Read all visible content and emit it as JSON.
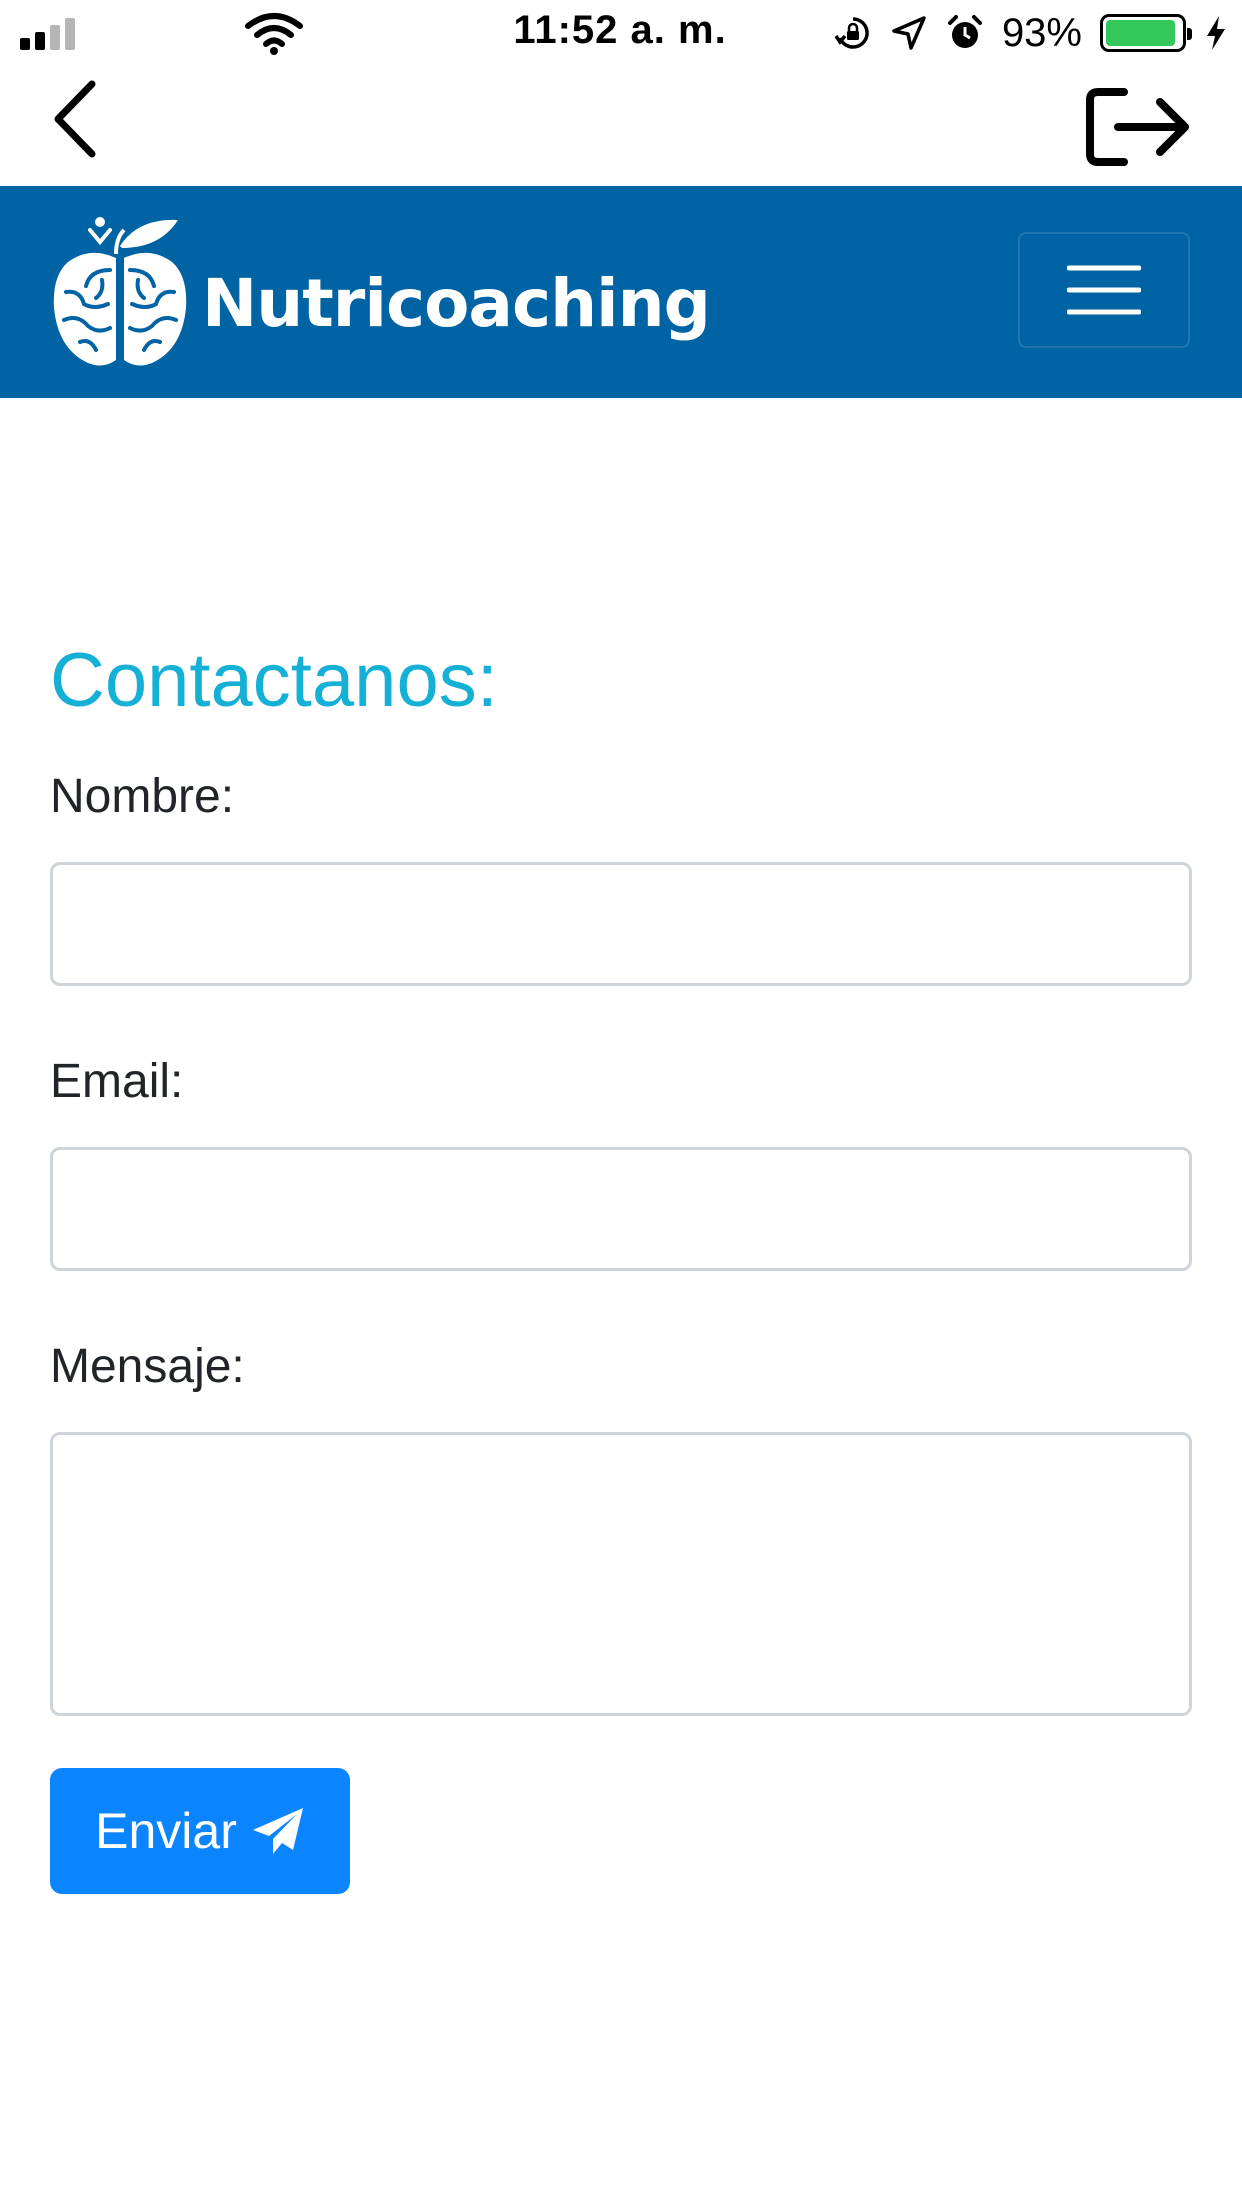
{
  "status_bar": {
    "time": "11:52 a. m.",
    "battery_percent": "93%",
    "battery_level": 0.93,
    "signal_bars_filled": 2,
    "signal_bars_total": 4,
    "icons": [
      "signal-icon",
      "wifi-icon",
      "orientation-lock-icon",
      "location-arrow-icon",
      "alarm-icon",
      "battery-icon",
      "charging-bolt-icon"
    ]
  },
  "nav": {
    "back_icon": "chevron-left-icon",
    "logout_icon": "logout-icon"
  },
  "navbar": {
    "brand_name": "Nutricoaching",
    "logo_icon": "apple-brain-logo-icon",
    "menu_icon": "hamburger-menu-icon"
  },
  "form": {
    "title": "Contactanos:",
    "name_label": "Nombre:",
    "name_value": "",
    "email_label": "Email:",
    "email_value": "",
    "message_label": "Mensaje:",
    "message_value": "",
    "submit_label": "Enviar",
    "submit_icon": "paper-plane-icon"
  },
  "colors": {
    "navbar_bg": "#0063a3",
    "title": "#15b0d6",
    "button_bg": "#0a84ff",
    "input_border": "#ced4da",
    "battery_fill": "#34c759"
  }
}
